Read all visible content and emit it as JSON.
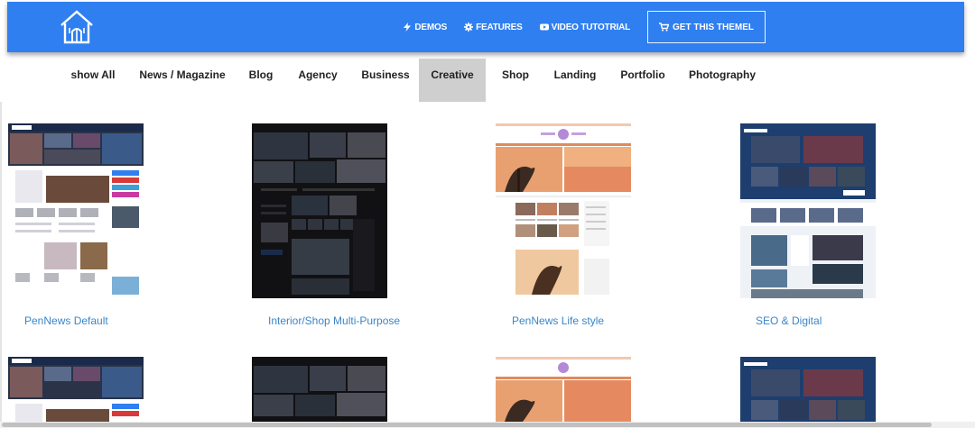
{
  "header": {
    "brand_color": "#2f7ff0",
    "logo_icon": "house-logo-icon",
    "nav": [
      {
        "label": "DEMOS",
        "icon": "lightning-icon"
      },
      {
        "label": "FEATURES",
        "icon": "gear-icon"
      },
      {
        "label": "VIDEO TUTOTRIAL",
        "icon": "youtube-play-icon"
      }
    ],
    "cta": {
      "label": "GET THIS THEMEL",
      "icon": "cart-icon"
    }
  },
  "filters": {
    "items": [
      "show All",
      "News / Magazine",
      "Blog",
      "Agency",
      "Business",
      "Creative",
      "Shop",
      "Landing",
      "Portfolio",
      "Photography"
    ],
    "active": "Creative"
  },
  "demos": {
    "row1": [
      {
        "title": "PenNews Default",
        "style": "light-news"
      },
      {
        "title": "Interior/Shop Multi-Purpose",
        "style": "dark-gallery"
      },
      {
        "title": "PenNews Life style",
        "style": "travel"
      },
      {
        "title": "SEO & Digital",
        "style": "video-blue"
      }
    ],
    "row2_styles": [
      "light-news",
      "dark-gallery",
      "travel",
      "video-blue"
    ]
  },
  "link_color": "#3a86c9",
  "active_filter_bg": "#cfcfcf"
}
